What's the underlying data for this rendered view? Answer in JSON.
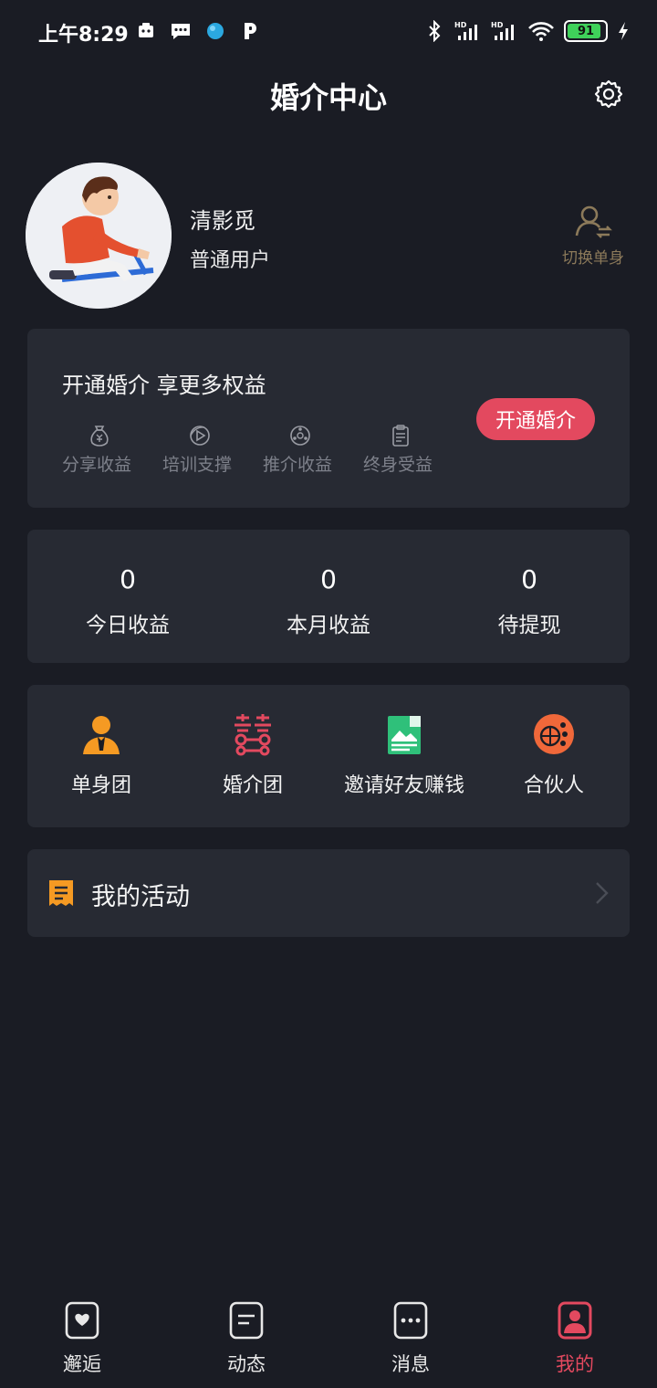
{
  "status_bar": {
    "time": "上午8:29",
    "battery": "91"
  },
  "header": {
    "title": "婚介中心"
  },
  "profile": {
    "name": "清影觅",
    "user_type": "普通用户",
    "switch_label": "切换单身"
  },
  "vip_card": {
    "title": "开通婚介 享更多权益",
    "benefits": [
      {
        "label": "分享收益",
        "icon": "money-bag-icon"
      },
      {
        "label": "培训支撑",
        "icon": "video-icon"
      },
      {
        "label": "推介收益",
        "icon": "network-icon"
      },
      {
        "label": "终身受益",
        "icon": "clipboard-icon"
      }
    ],
    "button_label": "开通婚介"
  },
  "stats": [
    {
      "value": "0",
      "label": "今日收益"
    },
    {
      "value": "0",
      "label": "本月收益"
    },
    {
      "value": "0",
      "label": "待提现"
    }
  ],
  "features": [
    {
      "label": "单身团",
      "icon": "person-icon"
    },
    {
      "label": "婚介团",
      "icon": "double-happiness-icon"
    },
    {
      "label": "邀请好友赚钱",
      "icon": "invite-image-icon"
    },
    {
      "label": "合伙人",
      "icon": "partner-globe-icon"
    }
  ],
  "activity": {
    "label": "我的活动"
  },
  "bottom_nav": [
    {
      "label": "邂逅",
      "icon": "heart-icon",
      "active": false
    },
    {
      "label": "动态",
      "icon": "feed-icon",
      "active": false
    },
    {
      "label": "消息",
      "icon": "message-icon",
      "active": false
    },
    {
      "label": "我的",
      "icon": "profile-icon",
      "active": true
    }
  ],
  "colors": {
    "background": "#1a1c24",
    "card": "#272a33",
    "accent": "#e3495f",
    "switch_text": "#8c7a5a",
    "muted_text": "#7d808a"
  }
}
